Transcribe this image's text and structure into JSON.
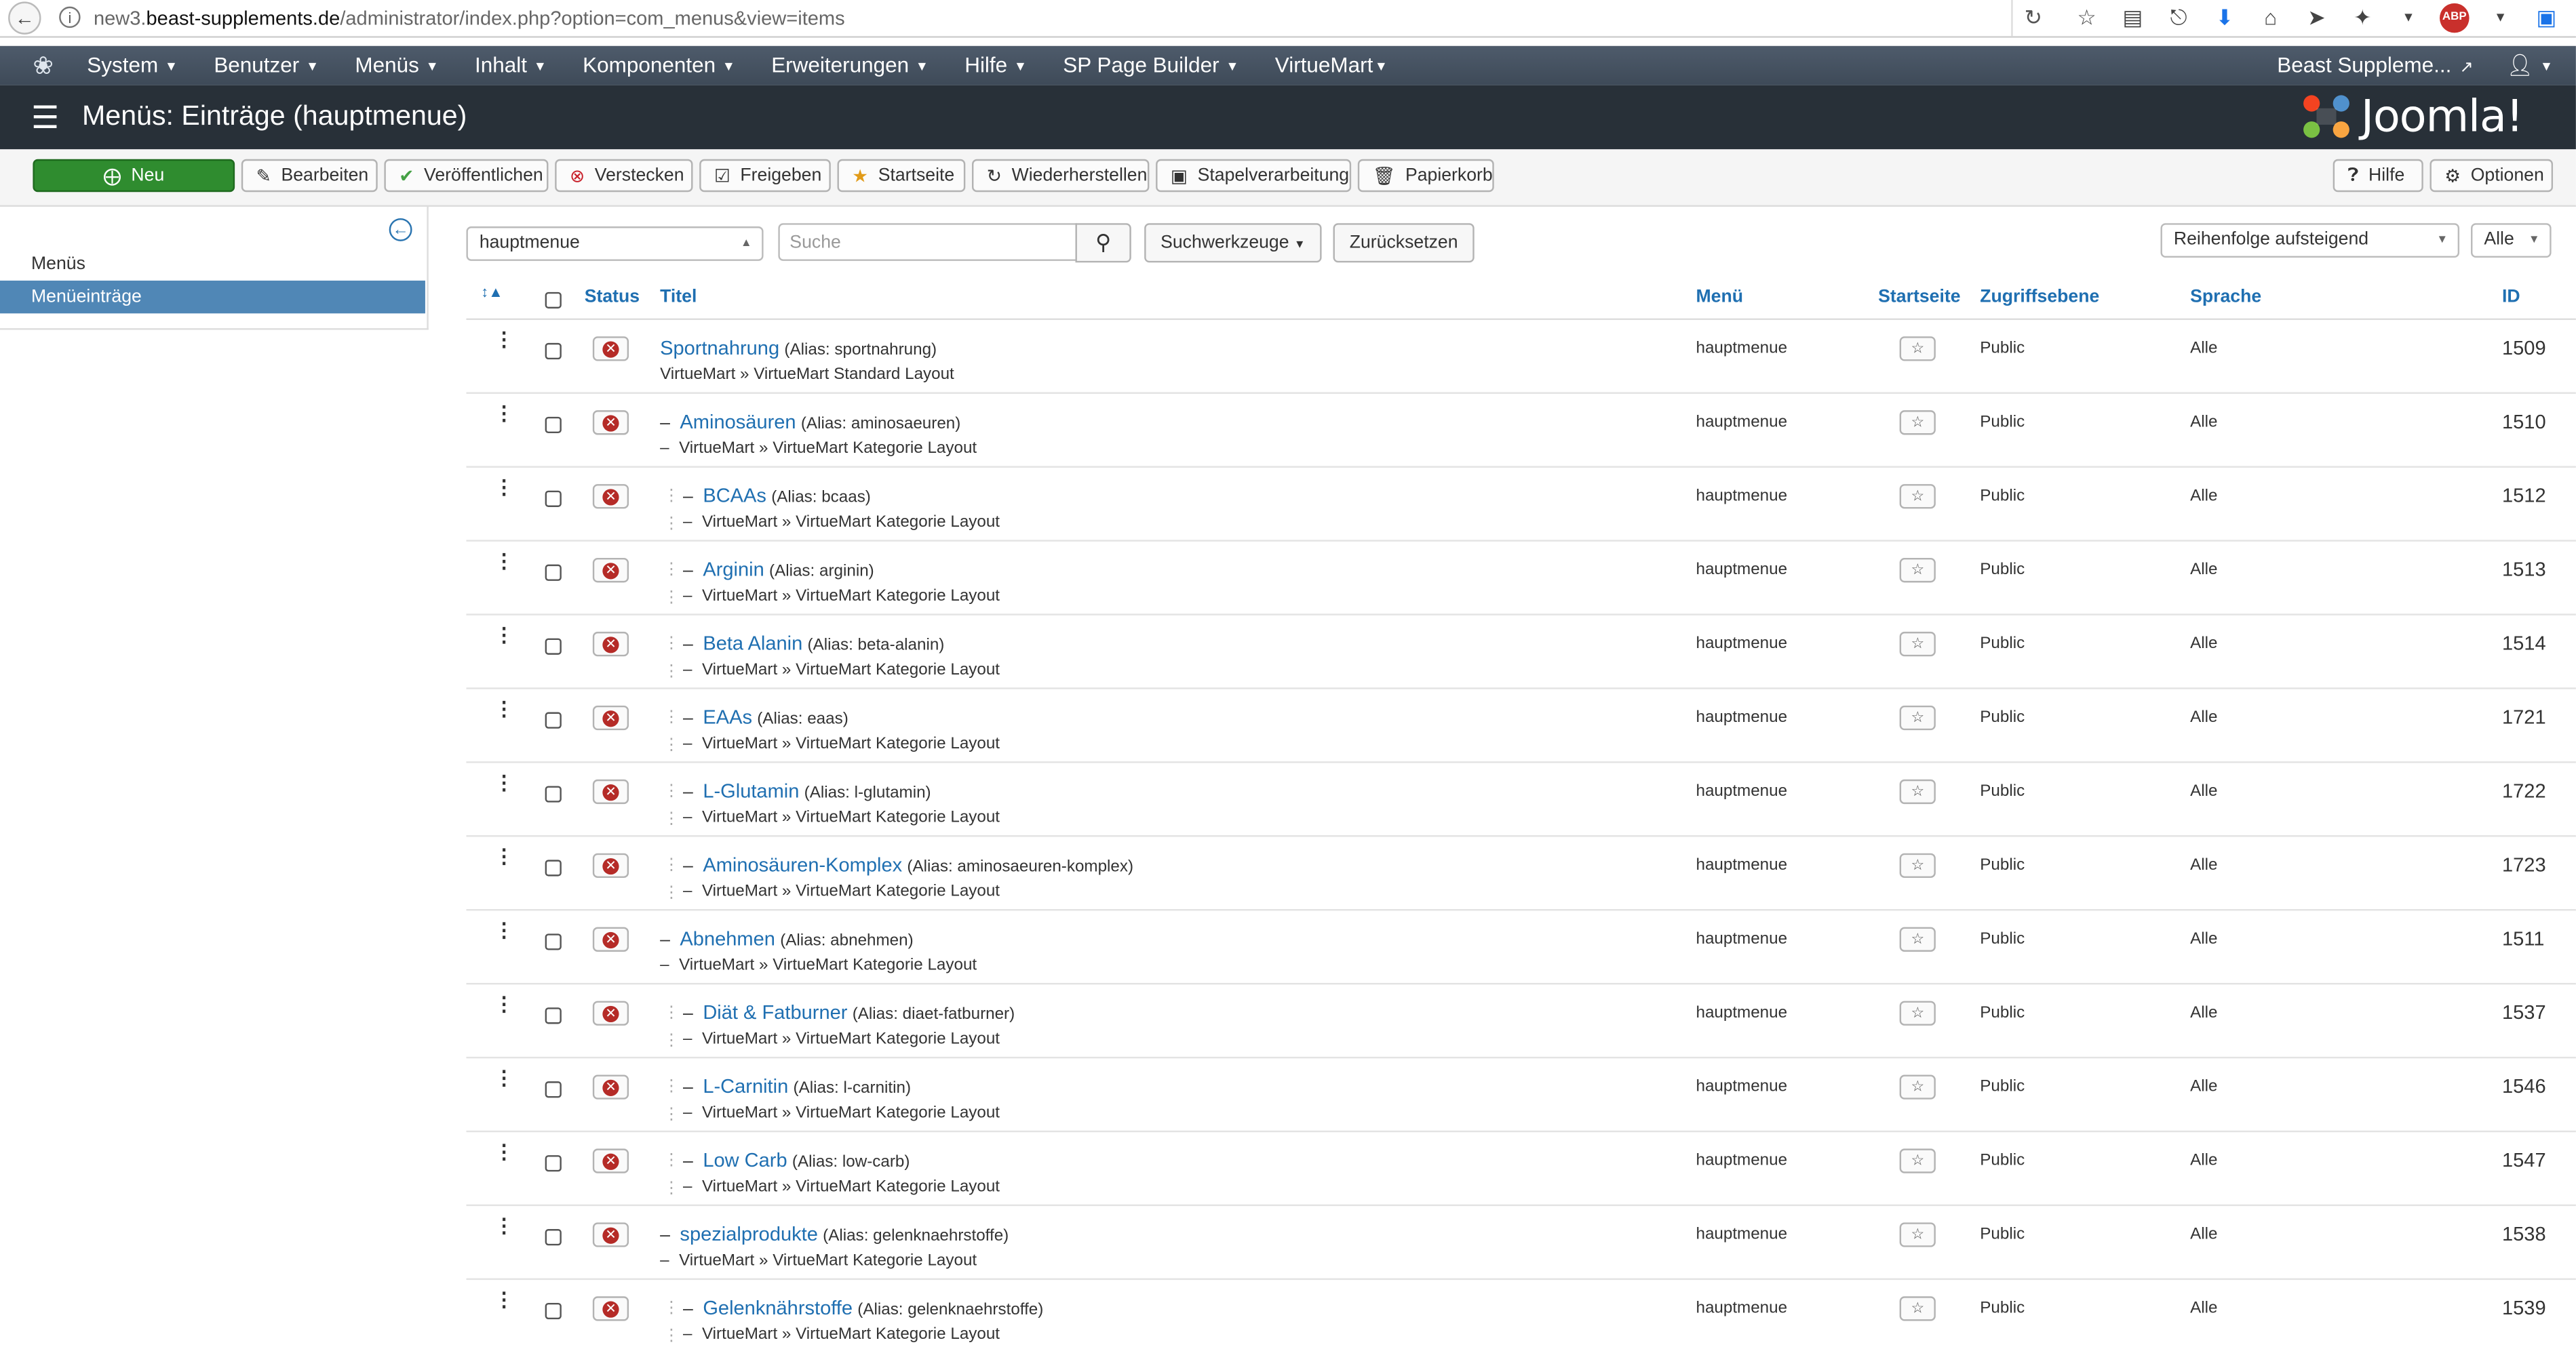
{
  "browser": {
    "url_prefix": "new3.",
    "url_domain": "beast-supplements.de",
    "url_path": "/administrator/index.php?option=com_menus&view=items"
  },
  "nav": {
    "items": [
      "System",
      "Benutzer",
      "Menüs",
      "Inhalt",
      "Komponenten",
      "Erweiterungen",
      "Hilfe",
      "SP Page Builder",
      "VirtueMart"
    ],
    "site_link": "Beast Suppleme...",
    "user_icon": "user-icon"
  },
  "header": {
    "title": "Menüs: Einträge (hauptmenue)",
    "logo_text": "Joomla!"
  },
  "toolbar": {
    "new": "Neu",
    "edit": "Bearbeiten",
    "publish": "Veröffentlichen",
    "unpublish": "Verstecken",
    "checkin": "Freigeben",
    "home": "Startseite",
    "rebuild": "Wiederherstellen",
    "batch": "Stapelverarbeitung",
    "trash": "Papierkorb",
    "help": "Hilfe",
    "options": "Optionen"
  },
  "sidebar": {
    "items": [
      "Menüs",
      "Menüeinträge"
    ],
    "active": "Menüeinträge"
  },
  "filters": {
    "menu_select": "hauptmenue",
    "search_placeholder": "Suche",
    "search_tools": "Suchwerkzeuge",
    "reset": "Zurücksetzen",
    "ordering": "Reihenfolge aufsteigend",
    "limit": "Alle"
  },
  "table": {
    "columns": {
      "status": "Status",
      "title": "Titel",
      "menu": "Menü",
      "home": "Startseite",
      "access": "Zugriffsebene",
      "language": "Sprache",
      "id": "ID"
    },
    "rows": [
      {
        "level": 1,
        "title": "Sportnahrung",
        "alias": "(Alias: sportnahrung)",
        "type": "VirtueMart » VirtueMart Standard Layout",
        "menu": "hauptmenue",
        "access": "Public",
        "language": "Alle",
        "id": "1509"
      },
      {
        "level": 2,
        "title": "Aminosäuren",
        "alias": "(Alias: aminosaeuren)",
        "type": "VirtueMart » VirtueMart Kategorie Layout",
        "menu": "hauptmenue",
        "access": "Public",
        "language": "Alle",
        "id": "1510"
      },
      {
        "level": 3,
        "title": "BCAAs",
        "alias": "(Alias: bcaas)",
        "type": "VirtueMart » VirtueMart Kategorie Layout",
        "menu": "hauptmenue",
        "access": "Public",
        "language": "Alle",
        "id": "1512"
      },
      {
        "level": 3,
        "title": "Arginin",
        "alias": "(Alias: arginin)",
        "type": "VirtueMart » VirtueMart Kategorie Layout",
        "menu": "hauptmenue",
        "access": "Public",
        "language": "Alle",
        "id": "1513"
      },
      {
        "level": 3,
        "title": "Beta Alanin",
        "alias": "(Alias: beta-alanin)",
        "type": "VirtueMart » VirtueMart Kategorie Layout",
        "menu": "hauptmenue",
        "access": "Public",
        "language": "Alle",
        "id": "1514"
      },
      {
        "level": 3,
        "title": "EAAs",
        "alias": "(Alias: eaas)",
        "type": "VirtueMart » VirtueMart Kategorie Layout",
        "menu": "hauptmenue",
        "access": "Public",
        "language": "Alle",
        "id": "1721"
      },
      {
        "level": 3,
        "title": "L-Glutamin",
        "alias": "(Alias: l-glutamin)",
        "type": "VirtueMart » VirtueMart Kategorie Layout",
        "menu": "hauptmenue",
        "access": "Public",
        "language": "Alle",
        "id": "1722"
      },
      {
        "level": 3,
        "title": "Aminosäuren-Komplex",
        "alias": "(Alias: aminosaeuren-komplex)",
        "type": "VirtueMart » VirtueMart Kategorie Layout",
        "menu": "hauptmenue",
        "access": "Public",
        "language": "Alle",
        "id": "1723"
      },
      {
        "level": 2,
        "title": "Abnehmen",
        "alias": "(Alias: abnehmen)",
        "type": "VirtueMart » VirtueMart Kategorie Layout",
        "menu": "hauptmenue",
        "access": "Public",
        "language": "Alle",
        "id": "1511"
      },
      {
        "level": 3,
        "title": "Diät & Fatburner",
        "alias": "(Alias: diaet-fatburner)",
        "type": "VirtueMart » VirtueMart Kategorie Layout",
        "menu": "hauptmenue",
        "access": "Public",
        "language": "Alle",
        "id": "1537"
      },
      {
        "level": 3,
        "title": "L-Carnitin",
        "alias": "(Alias: l-carnitin)",
        "type": "VirtueMart » VirtueMart Kategorie Layout",
        "menu": "hauptmenue",
        "access": "Public",
        "language": "Alle",
        "id": "1546"
      },
      {
        "level": 3,
        "title": "Low Carb",
        "alias": "(Alias: low-carb)",
        "type": "VirtueMart » VirtueMart Kategorie Layout",
        "menu": "hauptmenue",
        "access": "Public",
        "language": "Alle",
        "id": "1547"
      },
      {
        "level": 2,
        "title": "spezialprodukte",
        "alias": "(Alias: gelenknaehrstoffe)",
        "type": "VirtueMart » VirtueMart Kategorie Layout",
        "menu": "hauptmenue",
        "access": "Public",
        "language": "Alle",
        "id": "1538"
      },
      {
        "level": 3,
        "title": "Gelenknährstoffe",
        "alias": "(Alias: gelenknaehrstoffe)",
        "type": "VirtueMart » VirtueMart Kategorie Layout",
        "menu": "hauptmenue",
        "access": "Public",
        "language": "Alle",
        "id": "1539"
      }
    ]
  },
  "colors": {
    "link": "#1f6fb1",
    "nav_bg": "#46525f",
    "header_bg": "#283038",
    "new_button": "#2f8c2f",
    "sidebar_active": "#5087b6",
    "unpublished": "#b52b27"
  }
}
